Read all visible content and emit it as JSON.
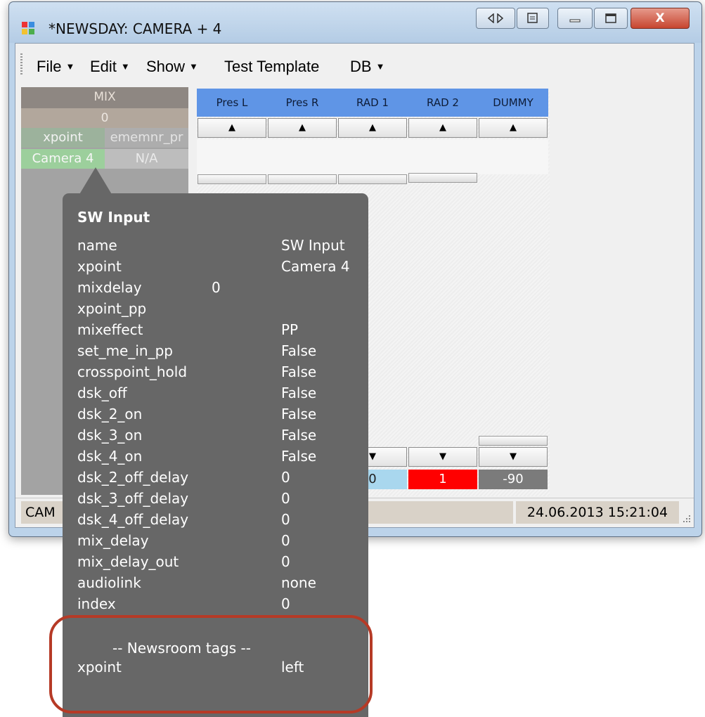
{
  "window": {
    "title": "*NEWSDAY: CAMERA + 4"
  },
  "menu": {
    "file": "File",
    "edit": "Edit",
    "show": "Show",
    "test_template": "Test Template",
    "db": "DB"
  },
  "mix": {
    "header": "MIX",
    "value": "0",
    "xpoint_label": "xpoint",
    "xpoint_col": "ememnr_pr",
    "camera": "Camera 4",
    "na": "N/A"
  },
  "grid": {
    "columns": [
      "Pres L",
      "Pres R",
      "RAD 1",
      "RAD 2",
      "DUMMY"
    ],
    "bottom_values": [
      "0",
      "1",
      "-90"
    ]
  },
  "status": {
    "left": "CAM",
    "datetime": "24.06.2013 15:21:04"
  },
  "tooltip": {
    "title": "SW Input",
    "rows": [
      {
        "key": "name",
        "value": "SW Input"
      },
      {
        "key": "xpoint",
        "value": "Camera 4"
      },
      {
        "key": "mixdelay",
        "value": "0"
      },
      {
        "key": "xpoint_pp",
        "value": ""
      },
      {
        "key": "mixeffect",
        "value": "PP"
      },
      {
        "key": "set_me_in_pp",
        "value": "False"
      },
      {
        "key": "crosspoint_hold",
        "value": "False"
      },
      {
        "key": "dsk_off",
        "value": "False"
      },
      {
        "key": "dsk_2_on",
        "value": "False"
      },
      {
        "key": "dsk_3_on",
        "value": "False"
      },
      {
        "key": "dsk_4_on",
        "value": "False"
      },
      {
        "key": "dsk_2_off_delay",
        "value": "0"
      },
      {
        "key": "dsk_3_off_delay",
        "value": "0"
      },
      {
        "key": "dsk_4_off_delay",
        "value": "0"
      },
      {
        "key": "mix_delay",
        "value": "0"
      },
      {
        "key": "mix_delay_out",
        "value": "0"
      },
      {
        "key": "audiolink",
        "value": "none"
      },
      {
        "key": "index",
        "value": "0"
      }
    ],
    "newsroom_title": "-- Newsroom tags --",
    "newsroom_rows": [
      {
        "key": "xpoint",
        "value": "left"
      }
    ]
  },
  "colors": {
    "column_header": "#5f95e6",
    "value_blue": "#a9d7ee",
    "value_red": "#ff0000",
    "value_gray": "#7b7b7b",
    "highlight": "#b63a26",
    "tooltip_bg": "#676767"
  }
}
